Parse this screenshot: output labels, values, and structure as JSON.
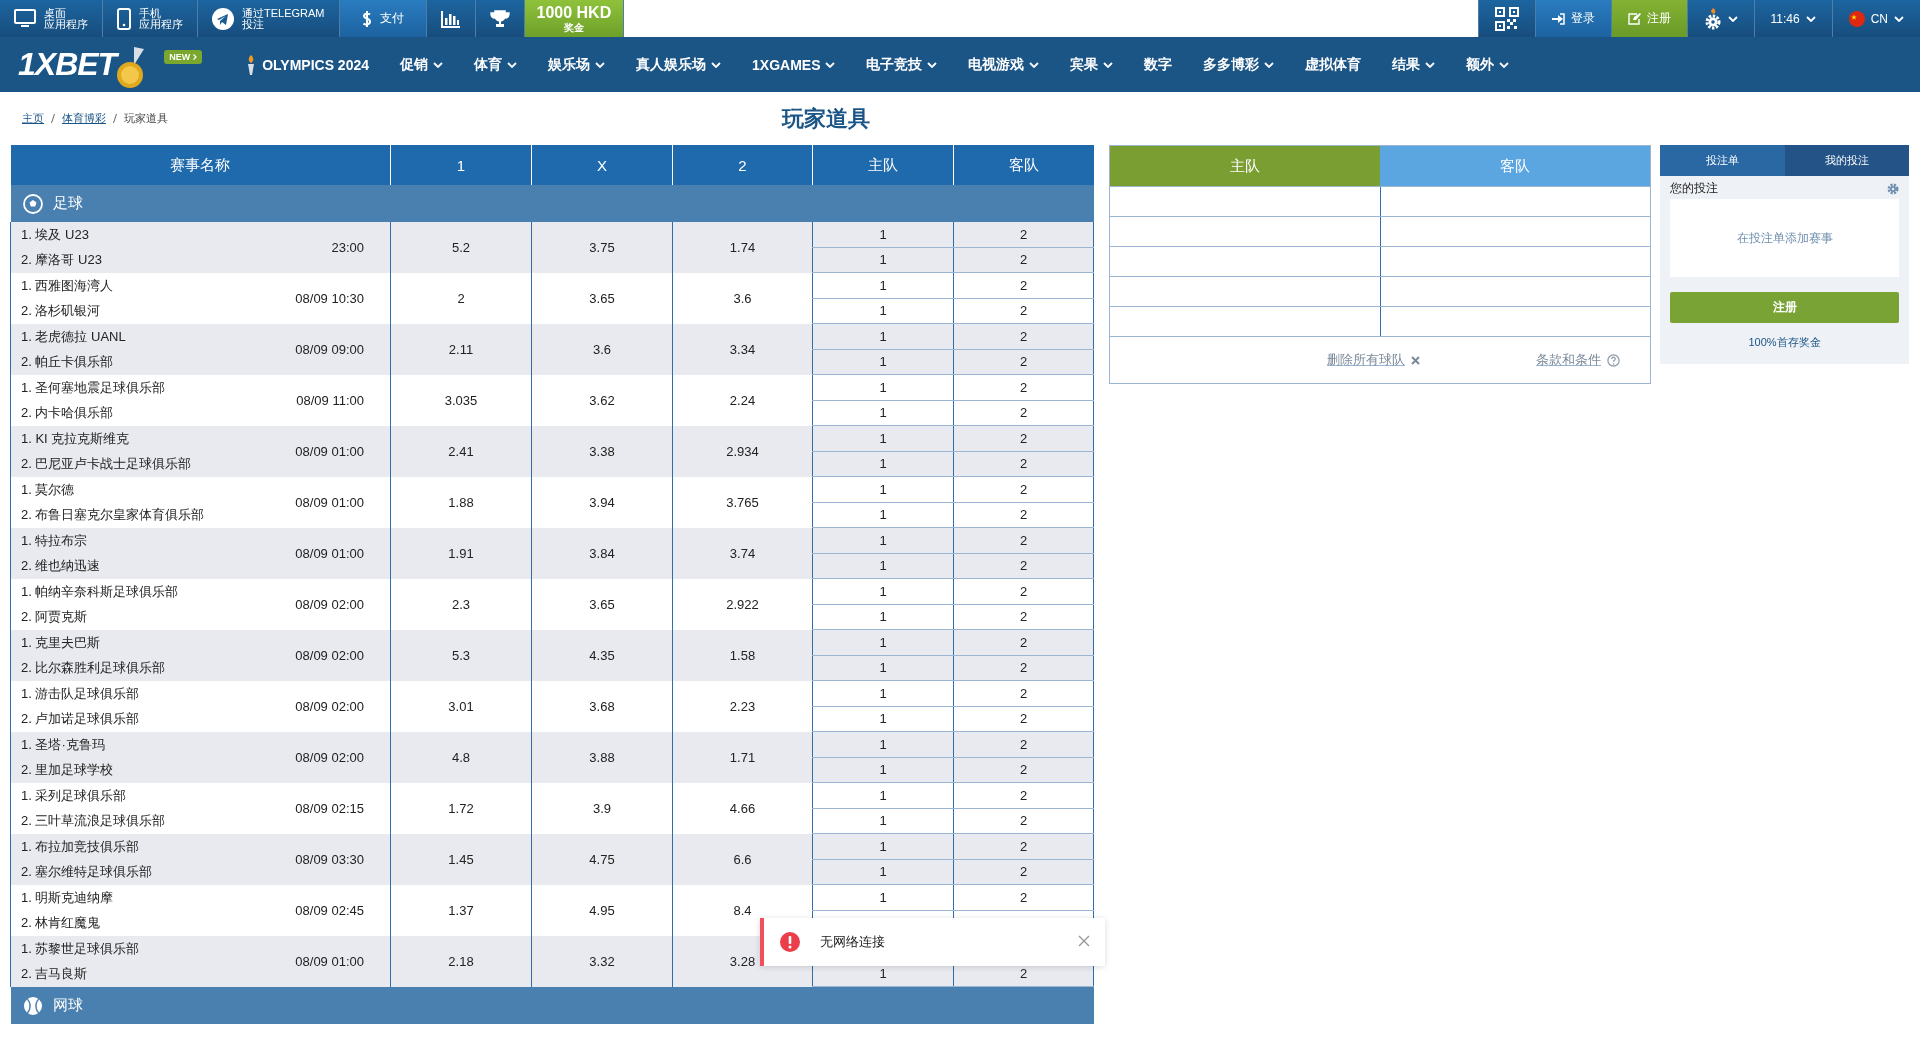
{
  "top_bar": {
    "left": [
      {
        "kind": "desktop",
        "lines": [
          "桌面",
          "应用程序"
        ]
      },
      {
        "kind": "phone",
        "lines": [
          "手机",
          "应用程序"
        ]
      },
      {
        "kind": "telegram",
        "lines": [
          "通过TELEGRAM",
          "投注"
        ]
      },
      {
        "kind": "dollar",
        "lines": [
          "支付"
        ]
      },
      {
        "kind": "chart"
      },
      {
        "kind": "trophy"
      },
      {
        "kind": "bonus",
        "lines": [
          "1000 HKD",
          "奖金"
        ]
      }
    ],
    "right": [
      {
        "kind": "qr"
      },
      {
        "kind": "login",
        "label": "登录"
      },
      {
        "kind": "register",
        "label": "注册"
      },
      {
        "kind": "settings"
      },
      {
        "kind": "time",
        "label": "11:46"
      },
      {
        "kind": "language",
        "label": "CN"
      }
    ]
  },
  "nav": {
    "logo": "1XBET",
    "badge": "NEW",
    "olympics": "OLYMPICS 2024",
    "items": [
      {
        "label": "促销",
        "dropdown": true
      },
      {
        "label": "体育",
        "dropdown": true
      },
      {
        "label": "娱乐场",
        "dropdown": true
      },
      {
        "label": "真人娱乐场",
        "dropdown": true
      },
      {
        "label": "1XGAMES",
        "dropdown": true
      },
      {
        "label": "电子竞技",
        "dropdown": true
      },
      {
        "label": "电视游戏",
        "dropdown": true
      },
      {
        "label": "宾果",
        "dropdown": true
      },
      {
        "label": "数字",
        "dropdown": false
      },
      {
        "label": "多多博彩",
        "dropdown": true
      },
      {
        "label": "虚拟体育",
        "dropdown": false
      },
      {
        "label": "结果",
        "dropdown": true
      },
      {
        "label": "额外",
        "dropdown": true
      }
    ]
  },
  "breadcrumbs": [
    "主页",
    "体育博彩",
    "玩家道具"
  ],
  "page_title": "玩家道具",
  "table": {
    "columns": [
      "赛事名称",
      "1",
      "X",
      "2",
      "主队",
      "客队"
    ],
    "sports": [
      {
        "kind": "football",
        "name": "足球",
        "rows": [
          {
            "team1": "1. 埃及 U23",
            "team2": "2. 摩洛哥 U23",
            "time": "23:00",
            "odds": [
              "5.2",
              "3.75",
              "1.74"
            ],
            "picks": [
              {
                "home": "1",
                "away": "2"
              },
              {
                "home": "1",
                "away": "2"
              }
            ]
          },
          {
            "team1": "1. 西雅图海湾人",
            "team2": "2. 洛杉矶银河",
            "time": "08/09 10:30",
            "odds": [
              "2",
              "3.65",
              "3.6"
            ],
            "picks": [
              {
                "home": "1",
                "away": "2"
              },
              {
                "home": "1",
                "away": "2"
              }
            ]
          },
          {
            "team1": "1. 老虎德拉 UANL",
            "team2": "2. 帕丘卡俱乐部",
            "time": "08/09 09:00",
            "odds": [
              "2.11",
              "3.6",
              "3.34"
            ],
            "picks": [
              {
                "home": "1",
                "away": "2"
              },
              {
                "home": "1",
                "away": "2"
              }
            ]
          },
          {
            "team1": "1. 圣何塞地震足球俱乐部",
            "team2": "2. 内卡哈俱乐部",
            "time": "08/09 11:00",
            "odds": [
              "3.035",
              "3.62",
              "2.24"
            ],
            "picks": [
              {
                "home": "1",
                "away": "2"
              },
              {
                "home": "1",
                "away": "2"
              }
            ]
          },
          {
            "team1": "1. KI 克拉克斯维克",
            "team2": "2. 巴尼亚卢卡战士足球俱乐部",
            "time": "08/09 01:00",
            "odds": [
              "2.41",
              "3.38",
              "2.934"
            ],
            "picks": [
              {
                "home": "1",
                "away": "2"
              },
              {
                "home": "1",
                "away": "2"
              }
            ]
          },
          {
            "team1": "1. 莫尔德",
            "team2": "2. 布鲁日塞克尔皇家体育俱乐部",
            "time": "08/09 01:00",
            "odds": [
              "1.88",
              "3.94",
              "3.765"
            ],
            "picks": [
              {
                "home": "1",
                "away": "2"
              },
              {
                "home": "1",
                "away": "2"
              }
            ]
          },
          {
            "team1": "1. 特拉布宗",
            "team2": "2. 维也纳迅速",
            "time": "08/09 01:00",
            "odds": [
              "1.91",
              "3.84",
              "3.74"
            ],
            "picks": [
              {
                "home": "1",
                "away": "2"
              },
              {
                "home": "1",
                "away": "2"
              }
            ]
          },
          {
            "team1": "1. 帕纳辛奈科斯足球俱乐部",
            "team2": "2. 阿贾克斯",
            "time": "08/09 02:00",
            "odds": [
              "2.3",
              "3.65",
              "2.922"
            ],
            "picks": [
              {
                "home": "1",
                "away": "2"
              },
              {
                "home": "1",
                "away": "2"
              }
            ]
          },
          {
            "team1": "1. 克里夫巴斯",
            "team2": "2. 比尔森胜利足球俱乐部",
            "time": "08/09 02:00",
            "odds": [
              "5.3",
              "4.35",
              "1.58"
            ],
            "picks": [
              {
                "home": "1",
                "away": "2"
              },
              {
                "home": "1",
                "away": "2"
              }
            ]
          },
          {
            "team1": "1. 游击队足球俱乐部",
            "team2": "2. 卢加诺足球俱乐部",
            "time": "08/09 02:00",
            "odds": [
              "3.01",
              "3.68",
              "2.23"
            ],
            "picks": [
              {
                "home": "1",
                "away": "2"
              },
              {
                "home": "1",
                "away": "2"
              }
            ]
          },
          {
            "team1": "1. 圣塔·克鲁玛",
            "team2": "2. 里加足球学校",
            "time": "08/09 02:00",
            "odds": [
              "4.8",
              "3.88",
              "1.71"
            ],
            "picks": [
              {
                "home": "1",
                "away": "2"
              },
              {
                "home": "1",
                "away": "2"
              }
            ]
          },
          {
            "team1": "1. 采列足球俱乐部",
            "team2": "2. 三叶草流浪足球俱乐部",
            "time": "08/09 02:15",
            "odds": [
              "1.72",
              "3.9",
              "4.66"
            ],
            "picks": [
              {
                "home": "1",
                "away": "2"
              },
              {
                "home": "1",
                "away": "2"
              }
            ]
          },
          {
            "team1": "1. 布拉加竞技俱乐部",
            "team2": "2. 塞尔维特足球俱乐部",
            "time": "08/09 03:30",
            "odds": [
              "1.45",
              "4.75",
              "6.6"
            ],
            "picks": [
              {
                "home": "1",
                "away": "2"
              },
              {
                "home": "1",
                "away": "2"
              }
            ]
          },
          {
            "team1": "1. 明斯克迪纳摩",
            "team2": "2. 林肯红魔鬼",
            "time": "08/09 02:45",
            "odds": [
              "1.37",
              "4.95",
              "8.4"
            ],
            "picks_top": {
              "home": "1",
              "away": "2"
            }
          },
          {
            "team1": "1. 苏黎世足球俱乐部",
            "team2": "2. 吉马良斯",
            "time": "08/09 01:00",
            "odds": [
              "2.18",
              "3.32",
              "3.28"
            ],
            "picks_bottom": {
              "home": "1",
              "away": "2"
            }
          }
        ]
      },
      {
        "kind": "tennis",
        "name": "网球"
      }
    ]
  },
  "teams_panel": {
    "columns": [
      "主队",
      "客队"
    ],
    "clear_link": "删除所有球队",
    "terms_link": "条款和条件"
  },
  "bet_slip": {
    "tabs": [
      {
        "label": "投注单",
        "selected": true
      },
      {
        "label": "我的投注",
        "selected": false
      }
    ],
    "heading": "您的投注",
    "empty_text": "在投注单添加赛事",
    "register_button": "注册",
    "bonus_link": "100%首存奖金"
  },
  "toast": {
    "message": "无网络连接"
  }
}
